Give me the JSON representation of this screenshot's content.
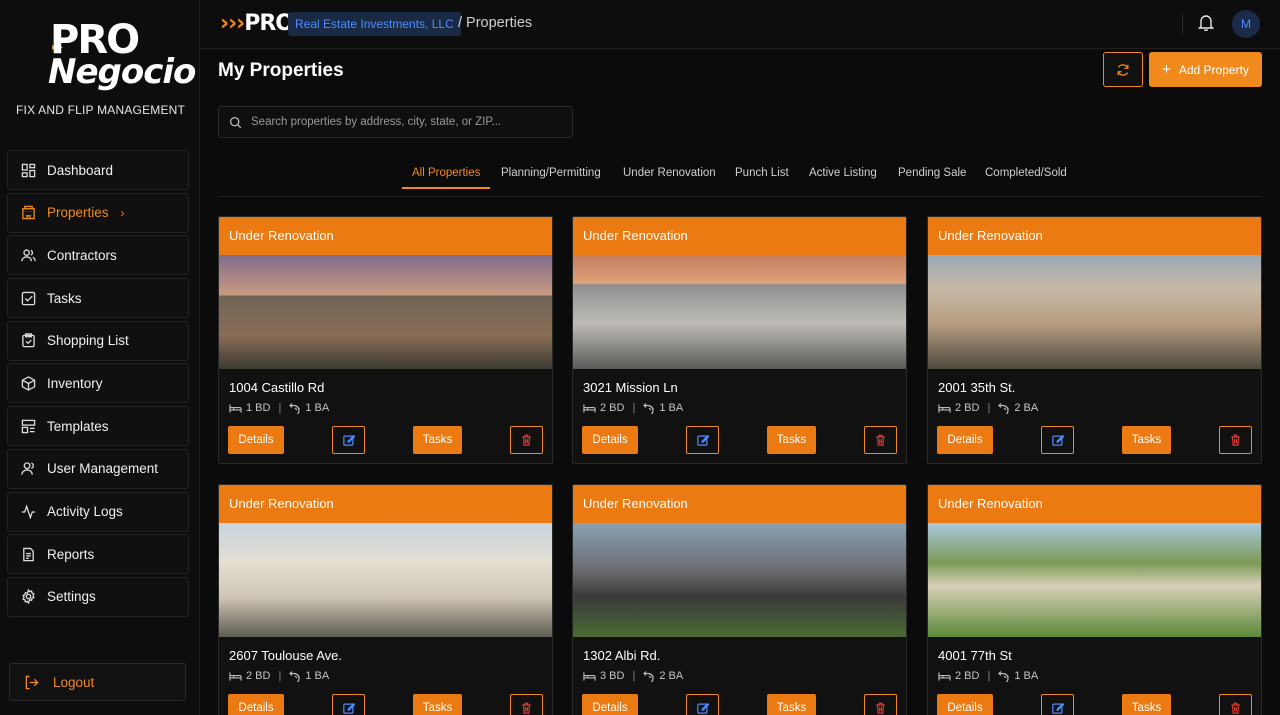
{
  "brand": {
    "logo_line1": "PRO",
    "logo_line2": "Negocio",
    "tagline": "FIX AND FLIP MANAGEMENT",
    "mini_logo": "PRO",
    "accent_color": "#f08a1c"
  },
  "sidebar": {
    "items": [
      {
        "label": "Dashboard",
        "icon": "dashboard-icon"
      },
      {
        "label": "Properties",
        "icon": "building-icon"
      },
      {
        "label": "Contractors",
        "icon": "users-icon"
      },
      {
        "label": "Tasks",
        "icon": "checkbox-icon"
      },
      {
        "label": "Shopping List",
        "icon": "clipboard-icon"
      },
      {
        "label": "Inventory",
        "icon": "box-icon"
      },
      {
        "label": "Templates",
        "icon": "template-icon"
      },
      {
        "label": "User Management",
        "icon": "user-icon"
      },
      {
        "label": "Activity Logs",
        "icon": "activity-icon"
      },
      {
        "label": "Reports",
        "icon": "report-icon"
      },
      {
        "label": "Settings",
        "icon": "gear-icon"
      }
    ],
    "active": "Properties",
    "logout_label": "Logout"
  },
  "topbar": {
    "company": "Real Estate Investments, LLC",
    "breadcrumb": "/ Properties",
    "avatar_initial": "M"
  },
  "main": {
    "title": "My Properties",
    "add_label": "Add Property",
    "search_placeholder": "Search properties by address, city, state, or ZIP...",
    "tabs": [
      "All Properties",
      "Planning/Permitting",
      "Under Renovation",
      "Punch List",
      "Active Listing",
      "Pending Sale",
      "Completed/Sold"
    ],
    "active_tab": "All Properties"
  },
  "cards": [
    {
      "status": "Under Renovation",
      "address": "1004 Castillo Rd",
      "beds": "1 BD",
      "baths": "1 BA",
      "details": "Details",
      "tasks": "Tasks"
    },
    {
      "status": "Under Renovation",
      "address": "3021 Mission Ln",
      "beds": "2 BD",
      "baths": "1 BA",
      "details": "Details",
      "tasks": "Tasks"
    },
    {
      "status": "Under Renovation",
      "address": "2001 35th St.",
      "beds": "2 BD",
      "baths": "2 BA",
      "details": "Details",
      "tasks": "Tasks"
    },
    {
      "status": "Under Renovation",
      "address": "2607 Toulouse Ave.",
      "beds": "2 BD",
      "baths": "1 BA",
      "details": "Details",
      "tasks": "Tasks"
    },
    {
      "status": "Under Renovation",
      "address": "1302 Albi Rd.",
      "beds": "3 BD",
      "baths": "2 BA",
      "details": "Details",
      "tasks": "Tasks"
    },
    {
      "status": "Under Renovation",
      "address": "4001 77th St",
      "beds": "2 BD",
      "baths": "1 BA",
      "details": "Details",
      "tasks": "Tasks"
    }
  ]
}
